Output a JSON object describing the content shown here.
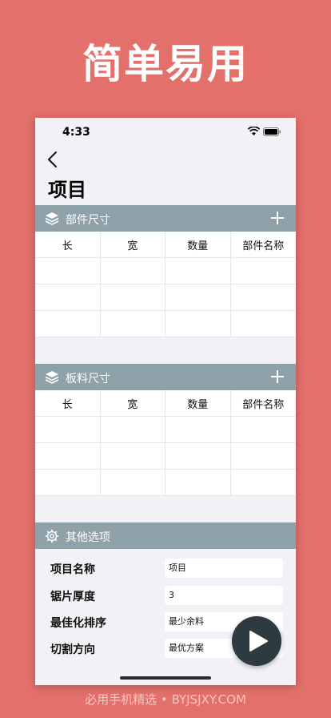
{
  "colors": {
    "background": "#e4706b",
    "section_header": "#8fa1a9",
    "play_button": "#2d3a3f"
  },
  "headline": "简单易用",
  "status_bar": {
    "time": "4:33"
  },
  "page": {
    "title": "项目"
  },
  "parts_section": {
    "title": "部件尺寸",
    "icon": "layers-icon",
    "columns": [
      "长",
      "宽",
      "数量",
      "部件名称"
    ]
  },
  "board_section": {
    "title": "板料尺寸",
    "icon": "layers-icon",
    "columns": [
      "长",
      "宽",
      "数量",
      "部件名称"
    ]
  },
  "options_section": {
    "title": "其他选项",
    "icon": "gear-icon",
    "rows": [
      {
        "label": "项目名称",
        "value": "项目"
      },
      {
        "label": "锯片厚度",
        "value": "3"
      },
      {
        "label": "最佳化排序",
        "value": "最少余料"
      },
      {
        "label": "切割方向",
        "value": "最优方案"
      }
    ]
  },
  "watermark": "必用手机精选 • BYJSJXY.COM"
}
